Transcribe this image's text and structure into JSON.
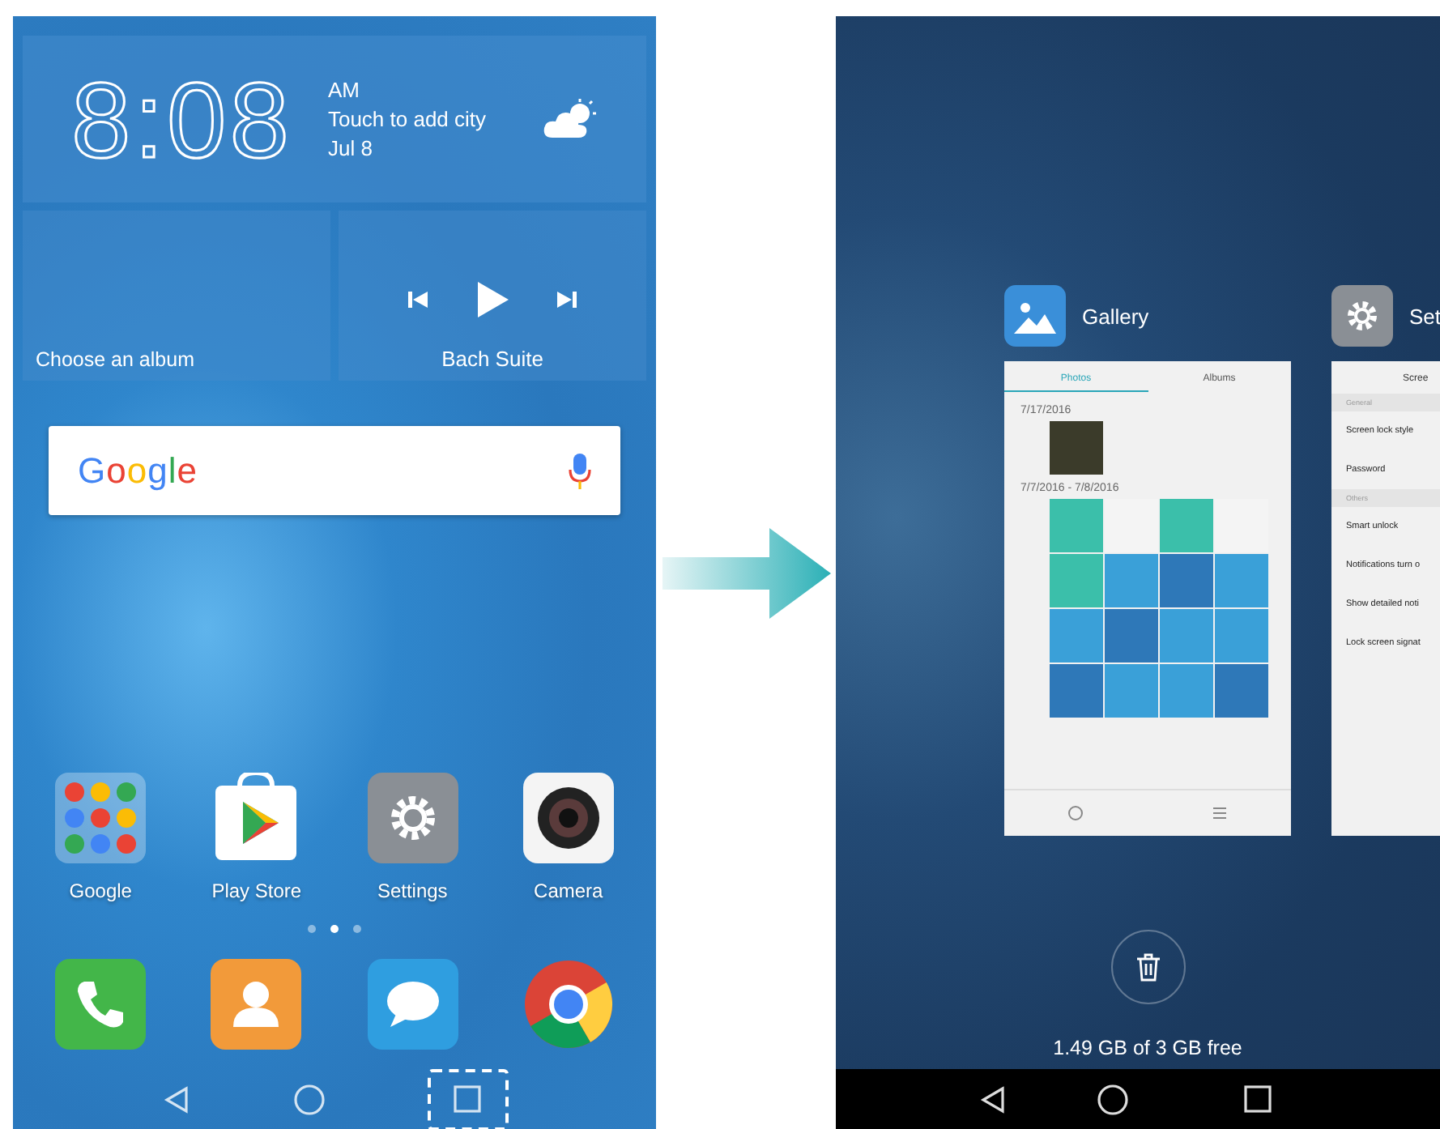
{
  "home_screen": {
    "clock": {
      "time": "8:08",
      "ampm": "AM",
      "city": "Touch to add city",
      "date": "Jul 8"
    },
    "album_widget": {
      "label": "Choose an album"
    },
    "music_widget": {
      "title": "Bach Suite"
    },
    "search_bar": {
      "logo": "Google"
    },
    "apps": [
      {
        "label": "Google",
        "kind": "folder"
      },
      {
        "label": "Play Store",
        "kind": "store"
      },
      {
        "label": "Settings",
        "kind": "settings"
      },
      {
        "label": "Camera",
        "kind": "camera"
      }
    ],
    "page_dots": [
      {
        "selected": false
      },
      {
        "selected": true
      },
      {
        "selected": false
      }
    ],
    "dock": [
      {
        "kind": "phone"
      },
      {
        "kind": "contacts"
      },
      {
        "kind": "messages"
      },
      {
        "kind": "browser"
      }
    ],
    "nav": {
      "recent_highlighted": true
    }
  },
  "recents_screen": {
    "cards": [
      {
        "kind": "gallery",
        "title": "Gallery",
        "tabs": [
          {
            "label": "Photos",
            "selected": true
          },
          {
            "label": "Albums",
            "selected": false
          }
        ],
        "groups": [
          {
            "date": "7/17/2016"
          },
          {
            "date": "7/7/2016 - 7/8/2016"
          }
        ]
      },
      {
        "kind": "settings",
        "title": "Set",
        "header": "Scree",
        "rows": [
          {
            "kind": "section",
            "label": "General"
          },
          {
            "kind": "item",
            "label": "Screen lock style"
          },
          {
            "kind": "item",
            "label": "Password"
          },
          {
            "kind": "section",
            "label": "Others"
          },
          {
            "kind": "item",
            "label": "Smart unlock"
          },
          {
            "kind": "item",
            "label": "Notifications turn o"
          },
          {
            "kind": "item",
            "label": "Show detailed noti"
          },
          {
            "kind": "item",
            "label": "Lock screen signat"
          }
        ]
      }
    ],
    "storage": "1.49 GB of 3 GB free"
  }
}
